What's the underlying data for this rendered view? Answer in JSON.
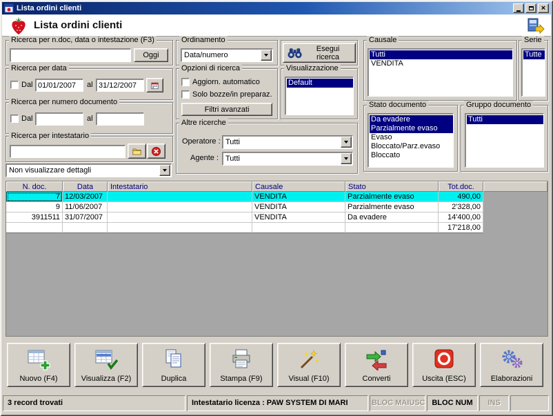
{
  "titlebar": {
    "title": "Lista ordini clienti"
  },
  "header": {
    "title": "Lista ordini clienti"
  },
  "panels": {
    "doc_search": {
      "title": "Ricerca per n.doc, data o intestazione (F3)",
      "input_value": "",
      "today_button": "Oggi"
    },
    "ordinamento": {
      "title": "Ordinamento",
      "selected": "Data/numero"
    },
    "esegui_button": "Esegui ricerca",
    "causale": {
      "title": "Causale",
      "items": [
        {
          "label": "Tutti",
          "selected": true
        },
        {
          "label": "VENDITA",
          "selected": false
        }
      ]
    },
    "serie": {
      "title": "Serie",
      "items": [
        {
          "label": "Tutte",
          "selected": true
        }
      ]
    },
    "ricerca_data": {
      "title": "Ricerca per data",
      "dal_label": "Dal",
      "dal_value": "01/01/2007",
      "al_label": "al",
      "al_value": "31/12/2007"
    },
    "opzioni": {
      "title": "Opzioni di ricerca",
      "auto_label": "Aggiorn. automatico",
      "bozze_label": "Solo bozze/in preparaz.",
      "filtri_button": "Filtri avanzati"
    },
    "visualizzazione": {
      "title": "Visualizzazione",
      "items": [
        {
          "label": "Default",
          "selected": true
        }
      ]
    },
    "ricerca_numero": {
      "title": "Ricerca per numero documento",
      "dal_label": "Dal",
      "dal_value": "",
      "al_label": "al",
      "al_value": ""
    },
    "stato_documento": {
      "title": "Stato documento",
      "items": [
        {
          "label": "Da evadere",
          "selected": true
        },
        {
          "label": "Parzialmente evaso",
          "selected": true
        },
        {
          "label": "Evaso",
          "selected": false
        },
        {
          "label": "Bloccato/Parz.evaso",
          "selected": false
        },
        {
          "label": "Bloccato",
          "selected": false
        }
      ]
    },
    "gruppo_documento": {
      "title": "Gruppo documento",
      "items": [
        {
          "label": "Tutti",
          "selected": true
        }
      ]
    },
    "ricerca_intestatario": {
      "title": "Ricerca per intestatario",
      "input_value": ""
    },
    "dettagli_select": {
      "selected": "Non visualizzare dettagli"
    },
    "altre_ricerche": {
      "title": "Altre ricerche",
      "operatore_label": "Operatore :",
      "operatore_value": "Tutti",
      "agente_label": "Agente :",
      "agente_value": "Tutti"
    }
  },
  "grid": {
    "columns": [
      "N. doc.",
      "Data",
      "Intestatario",
      "Causale",
      "Stato",
      "Tot.doc."
    ],
    "rows": [
      {
        "ndoc": "7",
        "data": "12/03/2007",
        "intestatario": "",
        "causale": "VENDITA",
        "stato": "Parzialmente evaso",
        "tot": "490,00"
      },
      {
        "ndoc": "9",
        "data": "11/06/2007",
        "intestatario": "",
        "causale": "VENDITA",
        "stato": "Parzialmente evaso",
        "tot": "2'328,00"
      },
      {
        "ndoc": "3911511",
        "data": "31/07/2007",
        "intestatario": "",
        "causale": "VENDITA",
        "stato": "Da evadere",
        "tot": "14'400,00"
      }
    ],
    "total": "17'218,00"
  },
  "toolbar": {
    "buttons": [
      {
        "label": "Nuovo (F4)",
        "icon": "new-table-icon"
      },
      {
        "label": "Visualizza (F2)",
        "icon": "view-table-icon"
      },
      {
        "label": "Duplica",
        "icon": "duplicate-icon"
      },
      {
        "label": "Stampa (F9)",
        "icon": "print-icon"
      },
      {
        "label": "Visual (F10)",
        "icon": "magic-wand-icon"
      },
      {
        "label": "Converti",
        "icon": "convert-icon"
      },
      {
        "label": "Uscita (ESC)",
        "icon": "exit-icon"
      },
      {
        "label": "Elaborazioni",
        "icon": "gears-icon"
      }
    ]
  },
  "statusbar": {
    "records": "3 record trovati",
    "license": "Intestatario licenza : PAW SYSTEM DI MARI",
    "caps": "BLOC MAIUSC",
    "num": "BLOC NUM",
    "ins": "INS"
  }
}
